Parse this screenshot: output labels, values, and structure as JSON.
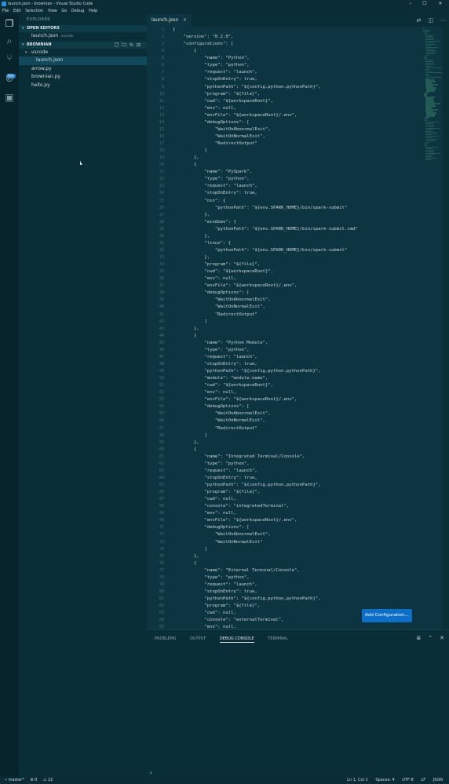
{
  "window": {
    "title": "launch.json - brownian - Visual Studio Code",
    "controls": {
      "minimize": "–",
      "maximize": "☐",
      "close": "✕"
    }
  },
  "menu": [
    "File",
    "Edit",
    "Selection",
    "View",
    "Go",
    "Debug",
    "Help"
  ],
  "activity": {
    "scm_badge": "99+"
  },
  "sidebar": {
    "header": "EXPLORER",
    "open_editors_label": "OPEN EDITORS",
    "open_editors": [
      {
        "name": "launch.json",
        "folder": ".vscode"
      }
    ],
    "folder_label": "BROWNIAN",
    "tree": [
      {
        "name": ".vscode",
        "type": "folder"
      },
      {
        "name": "launch.json",
        "type": "file"
      },
      {
        "name": "arrow.py",
        "type": "file"
      },
      {
        "name": "brownian.py",
        "type": "file"
      },
      {
        "name": "hello.py",
        "type": "file"
      }
    ]
  },
  "tab": {
    "label": "launch.json",
    "close": "×"
  },
  "editor": {
    "lines": [
      "{",
      "    \"version\": \"0.2.0\",",
      "    \"configurations\": [",
      "        {",
      "            \"name\": \"Python\",",
      "            \"type\": \"python\",",
      "            \"request\": \"launch\",",
      "            \"stopOnEntry\": true,",
      "            \"pythonPath\": \"${config.python.pythonPath}\",",
      "            \"program\": \"${file}\",",
      "            \"cwd\": \"${workspaceRoot}\",",
      "            \"env\": null,",
      "            \"envFile\": \"${workspaceRoot}/.env\",",
      "            \"debugOptions\": [",
      "                \"WaitOnAbnormalExit\",",
      "                \"WaitOnNormalExit\",",
      "                \"RedirectOutput\"",
      "            ]",
      "        },",
      "        {",
      "            \"name\": \"PySpark\",",
      "            \"type\": \"python\",",
      "            \"request\": \"launch\",",
      "            \"stopOnEntry\": true,",
      "            \"osx\": {",
      "                \"pythonPath\": \"${env.SPARK_HOME}/bin/spark-submit\"",
      "            },",
      "            \"windows\": {",
      "                \"pythonPath\": \"${env.SPARK_HOME}/bin/spark-submit.cmd\"",
      "            },",
      "            \"linux\": {",
      "                \"pythonPath\": \"${env.SPARK_HOME}/bin/spark-submit\"",
      "            },",
      "            \"program\": \"${file}\",",
      "            \"cwd\": \"${workspaceRoot}\",",
      "            \"env\": null,",
      "            \"envFile\": \"${workspaceRoot}/.env\",",
      "            \"debugOptions\": [",
      "                \"WaitOnAbnormalExit\",",
      "                \"WaitOnNormalExit\",",
      "                \"RedirectOutput\"",
      "            ]",
      "        },",
      "        {",
      "            \"name\": \"Python Module\",",
      "            \"type\": \"python\",",
      "            \"request\": \"launch\",",
      "            \"stopOnEntry\": true,",
      "            \"pythonPath\": \"${config.python.pythonPath}\",",
      "            \"module\": \"module.name\",",
      "            \"cwd\": \"${workspaceRoot}\",",
      "            \"env\": null,",
      "            \"envFile\": \"${workspaceRoot}/.env\",",
      "            \"debugOptions\": [",
      "                \"WaitOnAbnormalExit\",",
      "                \"WaitOnNormalExit\",",
      "                \"RedirectOutput\"",
      "            ]",
      "        },",
      "        {",
      "            \"name\": \"Integrated Terminal/Console\",",
      "            \"type\": \"python\",",
      "            \"request\": \"launch\",",
      "            \"stopOnEntry\": true,",
      "            \"pythonPath\": \"${config.python.pythonPath}\",",
      "            \"program\": \"${file}\",",
      "            \"cwd\": null,",
      "            \"console\": \"integratedTerminal\",",
      "            \"env\": null,",
      "            \"envFile\": \"${workspaceRoot}/.env\",",
      "            \"debugOptions\": [",
      "                \"WaitOnAbnormalExit\",",
      "                \"WaitOnNormalExit\"",
      "            ]",
      "        },",
      "        {",
      "            \"name\": \"External Terminal/Console\",",
      "            \"type\": \"python\",",
      "            \"request\": \"launch\",",
      "            \"stopOnEntry\": true,",
      "            \"pythonPath\": \"${config.python.pythonPath}\",",
      "            \"program\": \"${file}\",",
      "            \"cwd\": null,",
      "            \"console\": \"externalTerminal\",",
      "            \"env\": null,"
    ],
    "add_configuration": "Add Configuration..."
  },
  "panel": {
    "tabs": [
      "PROBLEMS",
      "OUTPUT",
      "DEBUG CONSOLE",
      "TERMINAL"
    ],
    "active_tab": "DEBUG CONSOLE",
    "prompt": "›"
  },
  "status": {
    "branch": "⑂ master*",
    "errors": "⊗ 0",
    "warnings": "⚠ 22",
    "position": "Ln 1, Col 1",
    "spaces": "Spaces: 4",
    "encoding": "UTF-8",
    "eol": "LF",
    "language": "JSON"
  },
  "colors": {
    "editor_bg": "#0c3541",
    "sidebar_bg": "#0a2e38",
    "accent_button": "#0e6fc8",
    "key_color": "#c9d5d8",
    "string_color": "#9fc7b6"
  }
}
